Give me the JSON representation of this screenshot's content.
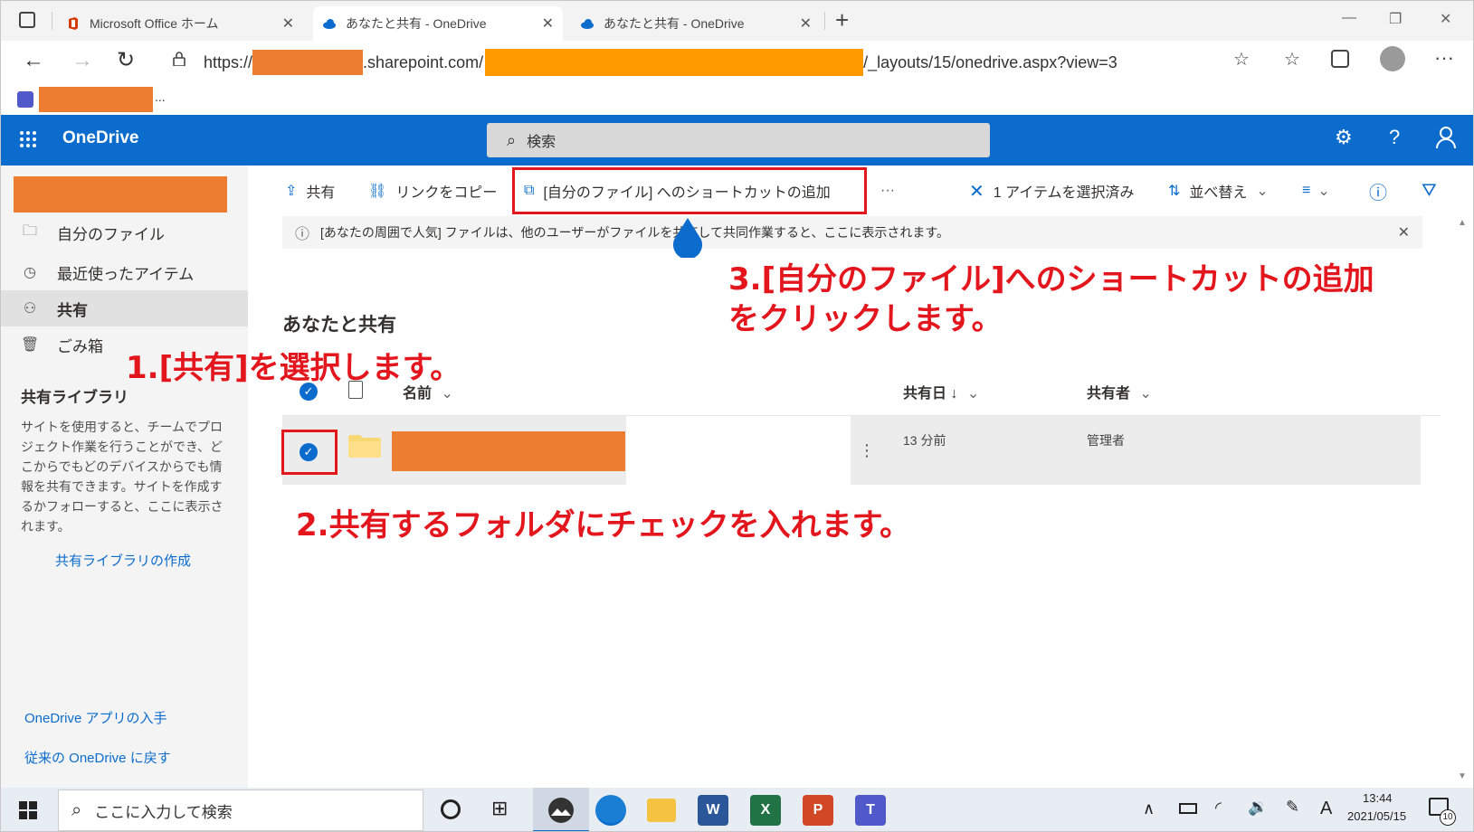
{
  "browser": {
    "tabs": [
      {
        "label": "Microsoft Office ホーム"
      },
      {
        "label": "あなたと共有 - OneDrive"
      },
      {
        "label": "あなたと共有 - OneDrive"
      }
    ],
    "url_prefix": "https://",
    "url_domain": ".sharepoint.com/",
    "url_path": "/_layouts/15/onedrive.aspx?view=3",
    "bookmark_more": "..."
  },
  "onedrive": {
    "app_name": "OneDrive",
    "search_placeholder": "検索"
  },
  "sidebar": {
    "items": [
      {
        "label": "自分のファイル",
        "icon": "folder-icon"
      },
      {
        "label": "最近使ったアイテム",
        "icon": "clock-icon"
      },
      {
        "label": "共有",
        "icon": "people-icon"
      },
      {
        "label": "ごみ箱",
        "icon": "trash-icon"
      }
    ],
    "library_heading": "共有ライブラリ",
    "library_desc": "サイトを使用すると、チームでプロジェクト作業を行うことができ、どこからでもどのデバイスからでも情報を共有できます。サイトを作成するかフォローすると、ここに表示されます。",
    "create_library_link": "共有ライブラリの作成",
    "get_app_link": "OneDrive アプリの入手",
    "classic_link": "従来の OneDrive に戻す"
  },
  "commandbar": {
    "share": "共有",
    "copy_link": "リンクをコピー",
    "add_shortcut": "[自分のファイル] へのショートカットの追加",
    "more": "···",
    "selected": "1 アイテムを選択済み",
    "sort": "並べ替え"
  },
  "content": {
    "info_message": "[あなたの周囲で人気] ファイルは、他のユーザーがファイルを共有して共同作業すると、ここに表示されます。",
    "page_title": "あなたと共有",
    "col_name": "名前",
    "col_shared_date": "共有日 ↓",
    "col_shared_by": "共有者",
    "row": {
      "shared_date": "13 分前",
      "shared_by": "管理者",
      "more": "⋮"
    }
  },
  "annotations": {
    "step1": "1.[共有]を選択します。",
    "step2": "2.共有するフォルダにチェックを入れます。",
    "step3_line1": "3.[自分のファイル]へのショートカットの追加",
    "step3_line2": "をクリックします。"
  },
  "taskbar": {
    "search_placeholder": "ここに入力して検索",
    "time": "13:44",
    "date": "2021/05/15",
    "ime": "A",
    "notification_count": "10"
  },
  "colors": {
    "onedrive_blue": "#0b6ccd",
    "annotation_red": "#e3161e",
    "redaction_orange": "#ed7d31"
  }
}
